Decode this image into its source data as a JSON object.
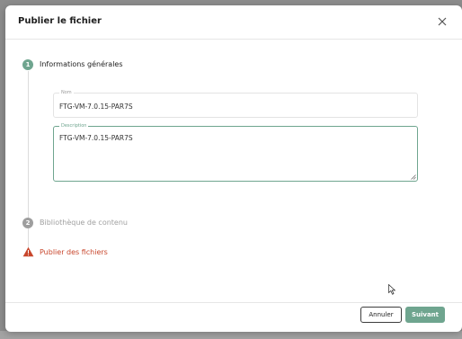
{
  "dialog": {
    "title": "Publier le fichier"
  },
  "stepper": {
    "steps": [
      {
        "number": "1",
        "label": "Informations générales",
        "state": "active"
      },
      {
        "number": "2",
        "label": "Bibliothèque de contenu",
        "state": "inactive"
      },
      {
        "number": "",
        "label": "Publier des fichiers",
        "state": "error",
        "icon": "warning-icon"
      }
    ]
  },
  "form": {
    "name": {
      "label": "Nom",
      "value": "FTG-VM-7.0.15-PAR7S"
    },
    "description": {
      "label": "Description",
      "value": "FTG-VM-7.0.15-PAR7S"
    }
  },
  "footer": {
    "cancel_label": "Annuler",
    "next_label": "Suivant"
  },
  "colors": {
    "accent": "#6fa58f",
    "step_active": "#6fa58f",
    "step_inactive": "#9e9e9e",
    "error": "#c8462c",
    "overlay": "#8c8c8c"
  }
}
